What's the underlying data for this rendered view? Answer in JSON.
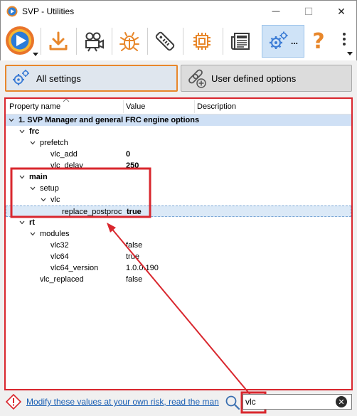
{
  "window": {
    "title": "SVP - Utilities",
    "minimize_glyph": "—",
    "maximize_glyph": "☐",
    "close_glyph": "✕"
  },
  "toolbar": {
    "items": [
      {
        "icon": "svp-logo-icon"
      },
      {
        "icon": "download-icon"
      },
      {
        "icon": "video-camera-icon"
      },
      {
        "icon": "bug-icon"
      },
      {
        "icon": "remote-control-icon"
      },
      {
        "icon": "chip-icon"
      },
      {
        "icon": "newspaper-icon"
      },
      {
        "icon": "gears-icon",
        "label": "...",
        "active": true
      },
      {
        "icon": "help-icon",
        "label": "?"
      },
      {
        "icon": "more-icon"
      }
    ],
    "accent": "#e8872b"
  },
  "modes": {
    "all_settings": "All settings",
    "user_defined": "User defined options"
  },
  "grid": {
    "columns": [
      "Property name",
      "Value",
      "Description"
    ],
    "rows": [
      {
        "level": 0,
        "name": "1. SVP Manager and general FRC engine options",
        "value": "",
        "group": true,
        "expanded": true
      },
      {
        "level": 1,
        "name": "frc",
        "value": "",
        "bold": true,
        "expanded": true
      },
      {
        "level": 2,
        "name": "prefetch",
        "value": "",
        "expanded": true
      },
      {
        "level": 3,
        "name": "vlc_add",
        "value": "0",
        "value_bold": true
      },
      {
        "level": 3,
        "name": "vlc_delay",
        "value": "250",
        "value_bold": true
      },
      {
        "level": 1,
        "name": "main",
        "value": "",
        "bold": true,
        "expanded": true
      },
      {
        "level": 2,
        "name": "setup",
        "value": "",
        "expanded": true
      },
      {
        "level": 3,
        "name": "vlc",
        "value": "",
        "expanded": true
      },
      {
        "level": 4,
        "name": "replace_postproc",
        "value": "true",
        "value_bold": true,
        "selected": true
      },
      {
        "level": 1,
        "name": "rt",
        "value": "",
        "bold": true,
        "expanded": true
      },
      {
        "level": 2,
        "name": "modules",
        "value": "",
        "expanded": true
      },
      {
        "level": 3,
        "name": "vlc32",
        "value": "false"
      },
      {
        "level": 3,
        "name": "vlc64",
        "value": "true"
      },
      {
        "level": 3,
        "name": "vlc64_version",
        "value": "1.0.0.190"
      },
      {
        "level": 2,
        "name": "vlc_replaced",
        "value": "false"
      }
    ]
  },
  "bottom": {
    "warning_text": "Modify these values at your own risk, read the man",
    "search_value": "vlc",
    "clear_glyph": "✕"
  },
  "colors": {
    "annotation_red": "#d9272e",
    "group_row": "#cfe0f5",
    "link": "#1a5fb4"
  }
}
